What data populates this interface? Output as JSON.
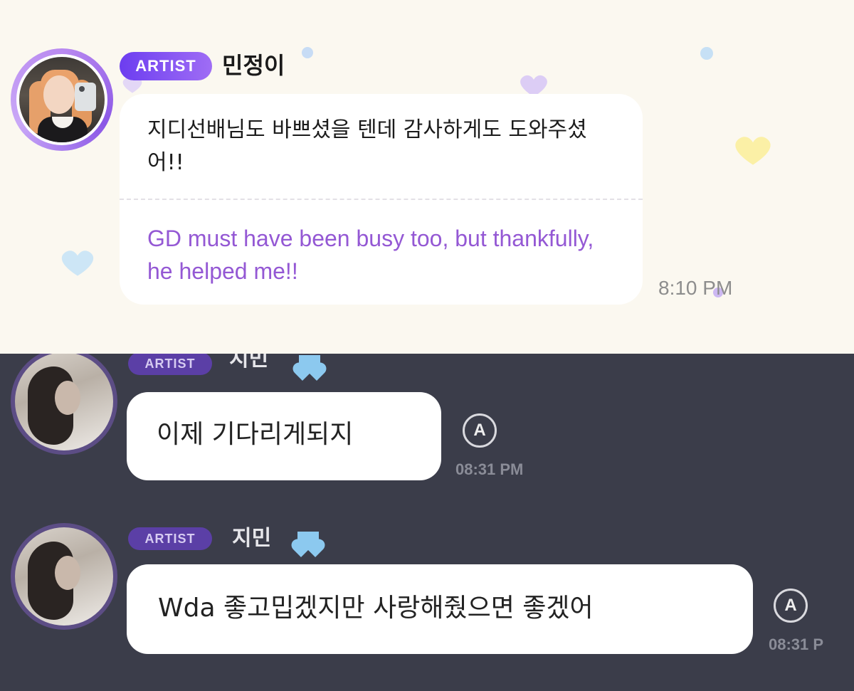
{
  "top_message": {
    "badge": "ARTIST",
    "sender": "민정이",
    "original_text": "지디선배님도 바쁘셨을 텐데 감사하게도 도와주셨어!!",
    "translation": "GD must have been busy too, but thankfully, he helped me!!",
    "time": "8:10 PM"
  },
  "bottom_messages": [
    {
      "badge": "ARTIST",
      "sender": "지민",
      "text": "이제 기다리게되지",
      "translate_icon": "A",
      "time": "08:31 PM"
    },
    {
      "badge": "ARTIST",
      "sender": "지민",
      "text": "Wda 좋고밉겠지만 사랑해줬으면 좋겠어",
      "translate_icon": "A",
      "time": "08:31 P"
    }
  ],
  "colors": {
    "top_background": "#fbf8f0",
    "bottom_background": "#3b3d4a",
    "artist_badge": "#7a4bf2",
    "translation_text": "#9458d4"
  }
}
